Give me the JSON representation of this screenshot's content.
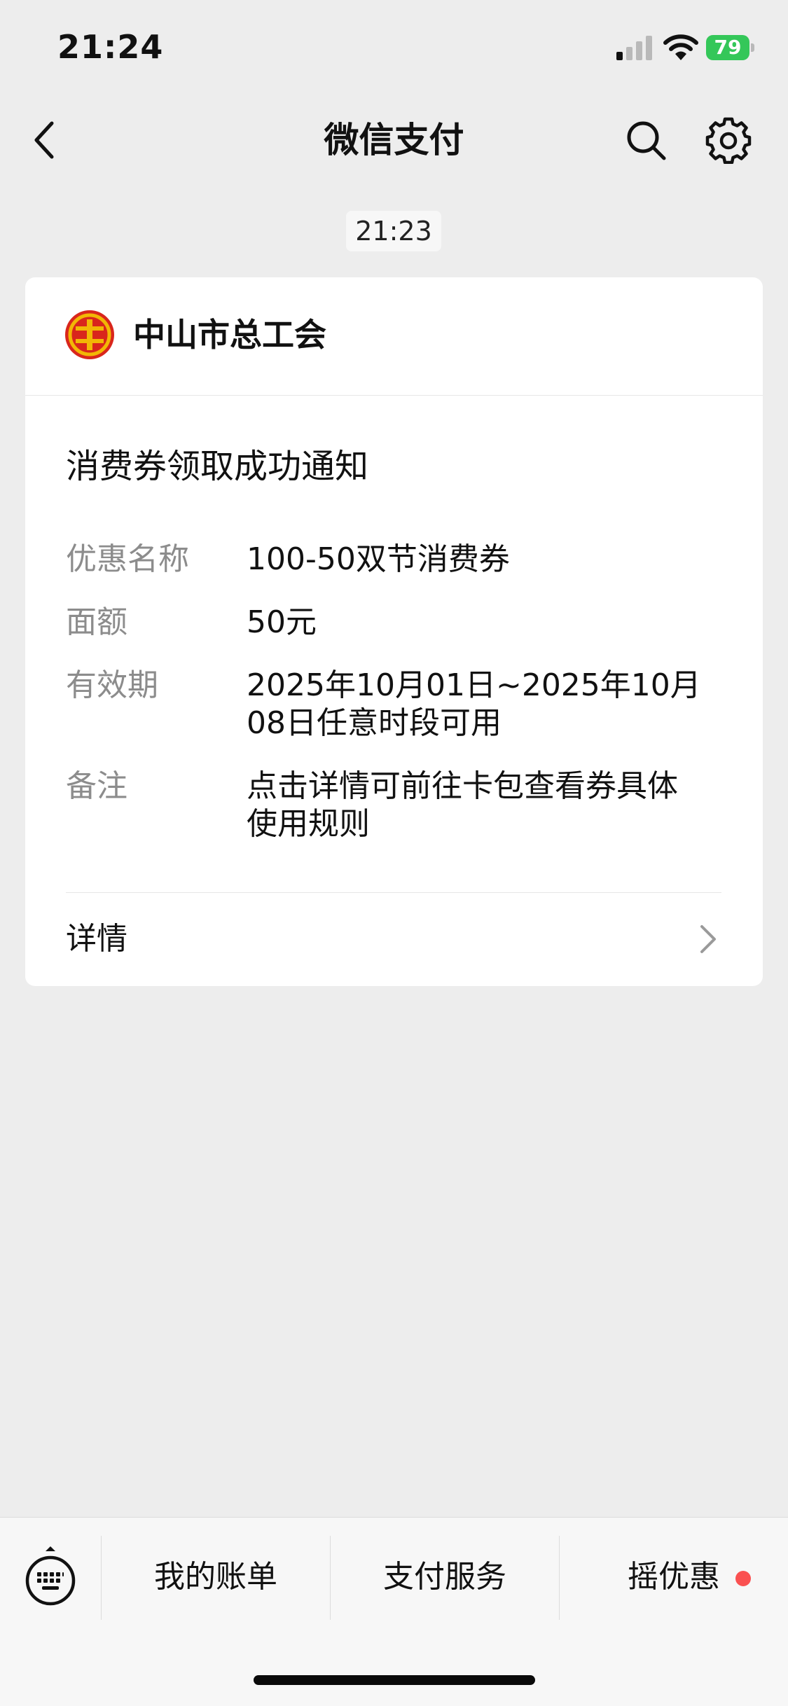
{
  "status_bar": {
    "time": "21:24",
    "battery": "79"
  },
  "nav": {
    "title": "微信支付"
  },
  "message": {
    "time": "21:23",
    "org_name": "中山市总工会",
    "title": "消费券领取成功通知",
    "fields": [
      {
        "label": "优惠名称",
        "value": "100-50双节消费券"
      },
      {
        "label": "面额",
        "value": "50元"
      },
      {
        "label": "有效期",
        "value": "2025年10月01日~2025年10月08日任意时段可用"
      },
      {
        "label": "备注",
        "value": "点击详情可前往卡包查看券具体使用规则"
      }
    ],
    "detail_label": "详情"
  },
  "bottom_bar": {
    "tabs": [
      "我的账单",
      "支付服务",
      "摇优惠"
    ]
  },
  "colors": {
    "background": "#ededed",
    "card": "#ffffff",
    "label_gray": "#8c8c8c",
    "battery_green": "#34c759",
    "red_dot": "#fa5151",
    "logo_red": "#d9261c",
    "logo_gold": "#f2b705"
  }
}
